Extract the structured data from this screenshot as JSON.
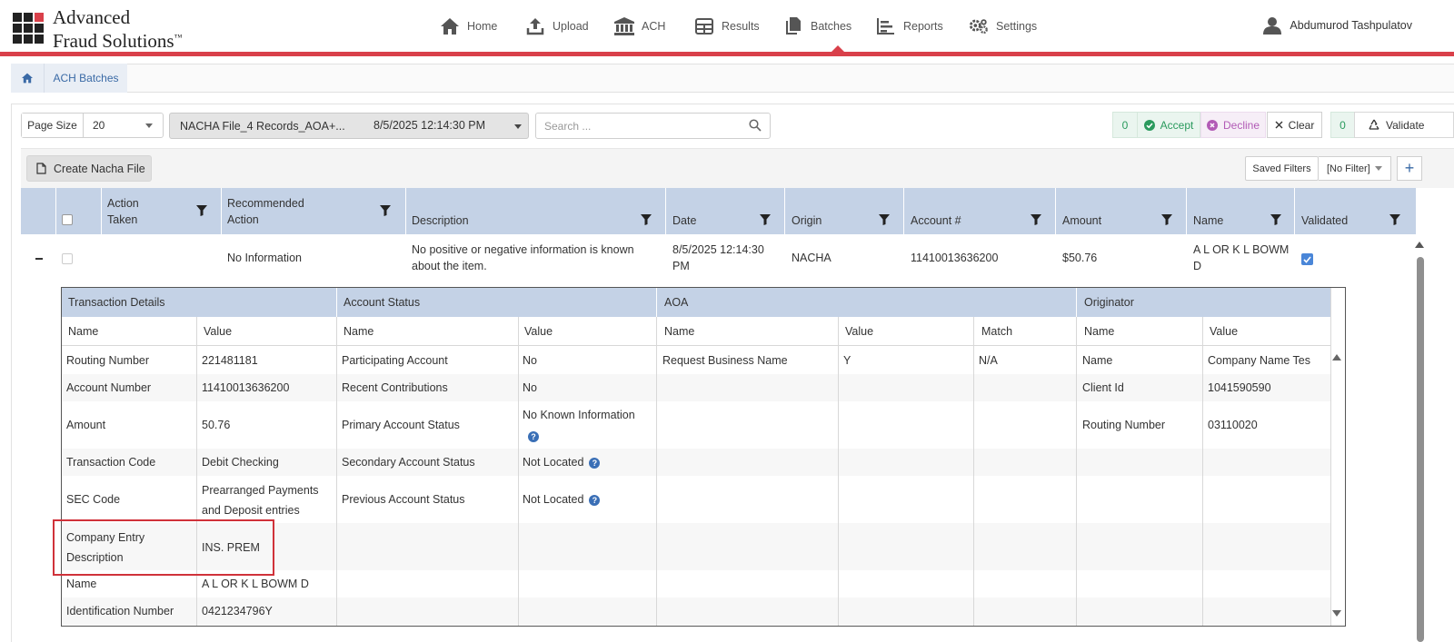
{
  "app": {
    "logo_line1": "Advanced",
    "logo_line2": "Fraud Solutions",
    "logo_tm": "™",
    "user_name": "Abdumurod Tashpulatov"
  },
  "nav": [
    {
      "label": "Home",
      "icon": "home-icon"
    },
    {
      "label": "Upload",
      "icon": "upload-icon"
    },
    {
      "label": "ACH",
      "icon": "bank-icon"
    },
    {
      "label": "Results",
      "icon": "table-icon"
    },
    {
      "label": "Batches",
      "icon": "copy-icon",
      "active": true
    },
    {
      "label": "Reports",
      "icon": "bar-chart-icon"
    },
    {
      "label": "Settings",
      "icon": "gears-icon"
    }
  ],
  "breadcrumb": {
    "current": "ACH Batches"
  },
  "toolbar": {
    "page_size_label": "Page Size",
    "page_size_value": "20",
    "file_name": "NACHA File_4 Records_AOA+...",
    "file_date": "8/5/2025 12:14:30 PM",
    "search_placeholder": "Search ...",
    "accept_count": "0",
    "accept_label": "Accept",
    "decline_label": "Decline",
    "clear_label": "Clear",
    "validate_count": "0",
    "validate_label": "Validate"
  },
  "toolbar2": {
    "create_label": "Create Nacha File",
    "saved_filters_label": "Saved Filters",
    "filter_value": "[No Filter]",
    "add_label": "+"
  },
  "grid": {
    "columns": {
      "action_taken": "Action Taken",
      "recommended_action": "Recommended Action",
      "description": "Description",
      "date": "Date",
      "origin": "Origin",
      "account": "Account #",
      "amount": "Amount",
      "name": "Name",
      "validated": "Validated"
    },
    "row": {
      "action_taken": "",
      "recommended_action": "No Information",
      "description": "No positive or negative information is known about the item.",
      "date_line1": "8/5/2025 12:14:30",
      "date_line2": "PM",
      "origin": "NACHA",
      "account": "11410013636200",
      "amount": "$50.76",
      "name_line1": "A L OR K L BOWM",
      "name_line2": "D",
      "validated": true
    }
  },
  "details": {
    "groups": {
      "transaction": "Transaction Details",
      "account_status": "Account Status",
      "aoa": "AOA",
      "originator": "Originator"
    },
    "sub": {
      "name": "Name",
      "value": "Value",
      "match": "Match"
    },
    "transaction_rows": [
      {
        "name": "Routing Number",
        "value": "221481181"
      },
      {
        "name": "Account Number",
        "value": "11410013636200"
      },
      {
        "name": "Amount",
        "value": "50.76"
      },
      {
        "name": "Transaction Code",
        "value": "Debit Checking"
      },
      {
        "name": "SEC Code",
        "value": "Prearranged Payments and Deposit entries"
      },
      {
        "name": "Company Entry Description",
        "value": "INS. PREM"
      },
      {
        "name": "Name",
        "value": "A L OR K L BOWM D"
      },
      {
        "name": "Identification Number",
        "value": "0421234796Y"
      }
    ],
    "account_status_rows": [
      {
        "name": "Participating Account",
        "value": "No",
        "help": false
      },
      {
        "name": "Recent Contributions",
        "value": "No",
        "help": false
      },
      {
        "name": "Primary Account Status",
        "value": "No Known Information",
        "help": true
      },
      {
        "name": "Secondary Account Status",
        "value": "Not Located",
        "help": true
      },
      {
        "name": "Previous Account Status",
        "value": "Not Located",
        "help": true
      }
    ],
    "aoa_rows": [
      {
        "name": "Request Business Name",
        "value": "Y",
        "match": "N/A"
      }
    ],
    "originator_rows": [
      {
        "name": "Name",
        "value": "Company Name Tes"
      },
      {
        "name": "Client Id",
        "value": "1041590590"
      },
      {
        "name": "Routing Number",
        "value": "03110020"
      }
    ]
  },
  "colors": {
    "brand_red": "#d9404a",
    "grid_header": "#c4d2e6",
    "accept_green": "#2a9a5d",
    "decline_purple": "#b25bb6",
    "link_blue": "#3a6aa6"
  }
}
